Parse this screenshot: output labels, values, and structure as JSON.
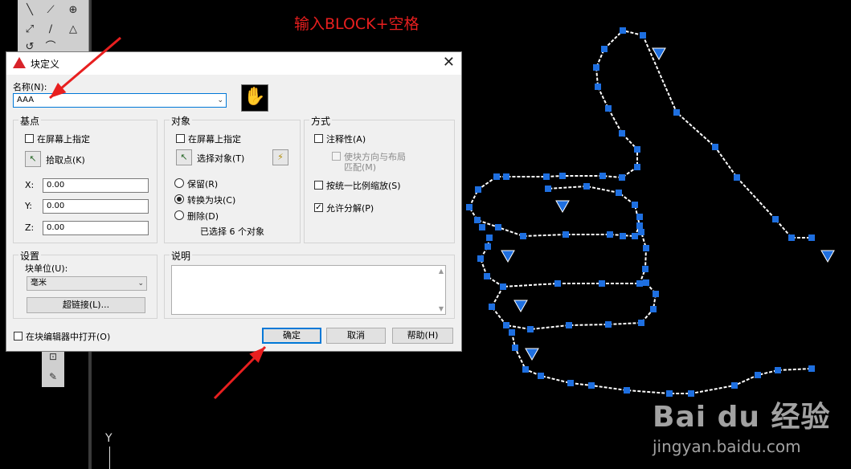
{
  "annotation": "输入BLOCK+空格",
  "ucs_y": "Y",
  "watermark": {
    "logo": "Bai du 经验",
    "url": "jingyan.baidu.com"
  },
  "toolbar": {
    "icons": [
      "line-icon",
      "arc-icon",
      "polyline-icon",
      "mirror-icon",
      "circle-icon",
      "spline-icon",
      "rotate-icon",
      "hatch-icon"
    ]
  },
  "dialog": {
    "title": "块定义",
    "close_glyph": "✕",
    "name": {
      "label": "名称(N):",
      "value": "AAA"
    },
    "base_point": {
      "title": "基点",
      "on_screen": "在屏幕上指定",
      "pick_point": "拾取点(K)",
      "x_label": "X:",
      "x_value": "0.00",
      "y_label": "Y:",
      "y_value": "0.00",
      "z_label": "Z:",
      "z_value": "0.00"
    },
    "objects": {
      "title": "对象",
      "on_screen": "在屏幕上指定",
      "select_objects": "选择对象(T)",
      "retain": "保留(R)",
      "convert": "转换为块(C)",
      "delete": "删除(D)",
      "selected_count": "已选择 6 个对象"
    },
    "behavior": {
      "title": "方式",
      "annotative": "注释性(A)",
      "match_orientation": "使块方向与布局",
      "match_orientation_2": "匹配(M)",
      "scale_uniformly": "按统一比例缩放(S)",
      "allow_explode": "允许分解(P)",
      "allow_explode_checked": true
    },
    "settings": {
      "title": "设置",
      "unit_label": "块单位(U):",
      "unit_value": "毫米",
      "hyperlink": "超链接(L)..."
    },
    "description": {
      "title": "说明"
    },
    "open_in_editor": "在块编辑器中打开(O)",
    "ok": "确定",
    "cancel": "取消",
    "help": "帮助(H)"
  },
  "colors": {
    "grip": "#1e6fe0",
    "arrow": "#e81f1f",
    "annotation": "#e81f1f",
    "background": "#000000"
  }
}
